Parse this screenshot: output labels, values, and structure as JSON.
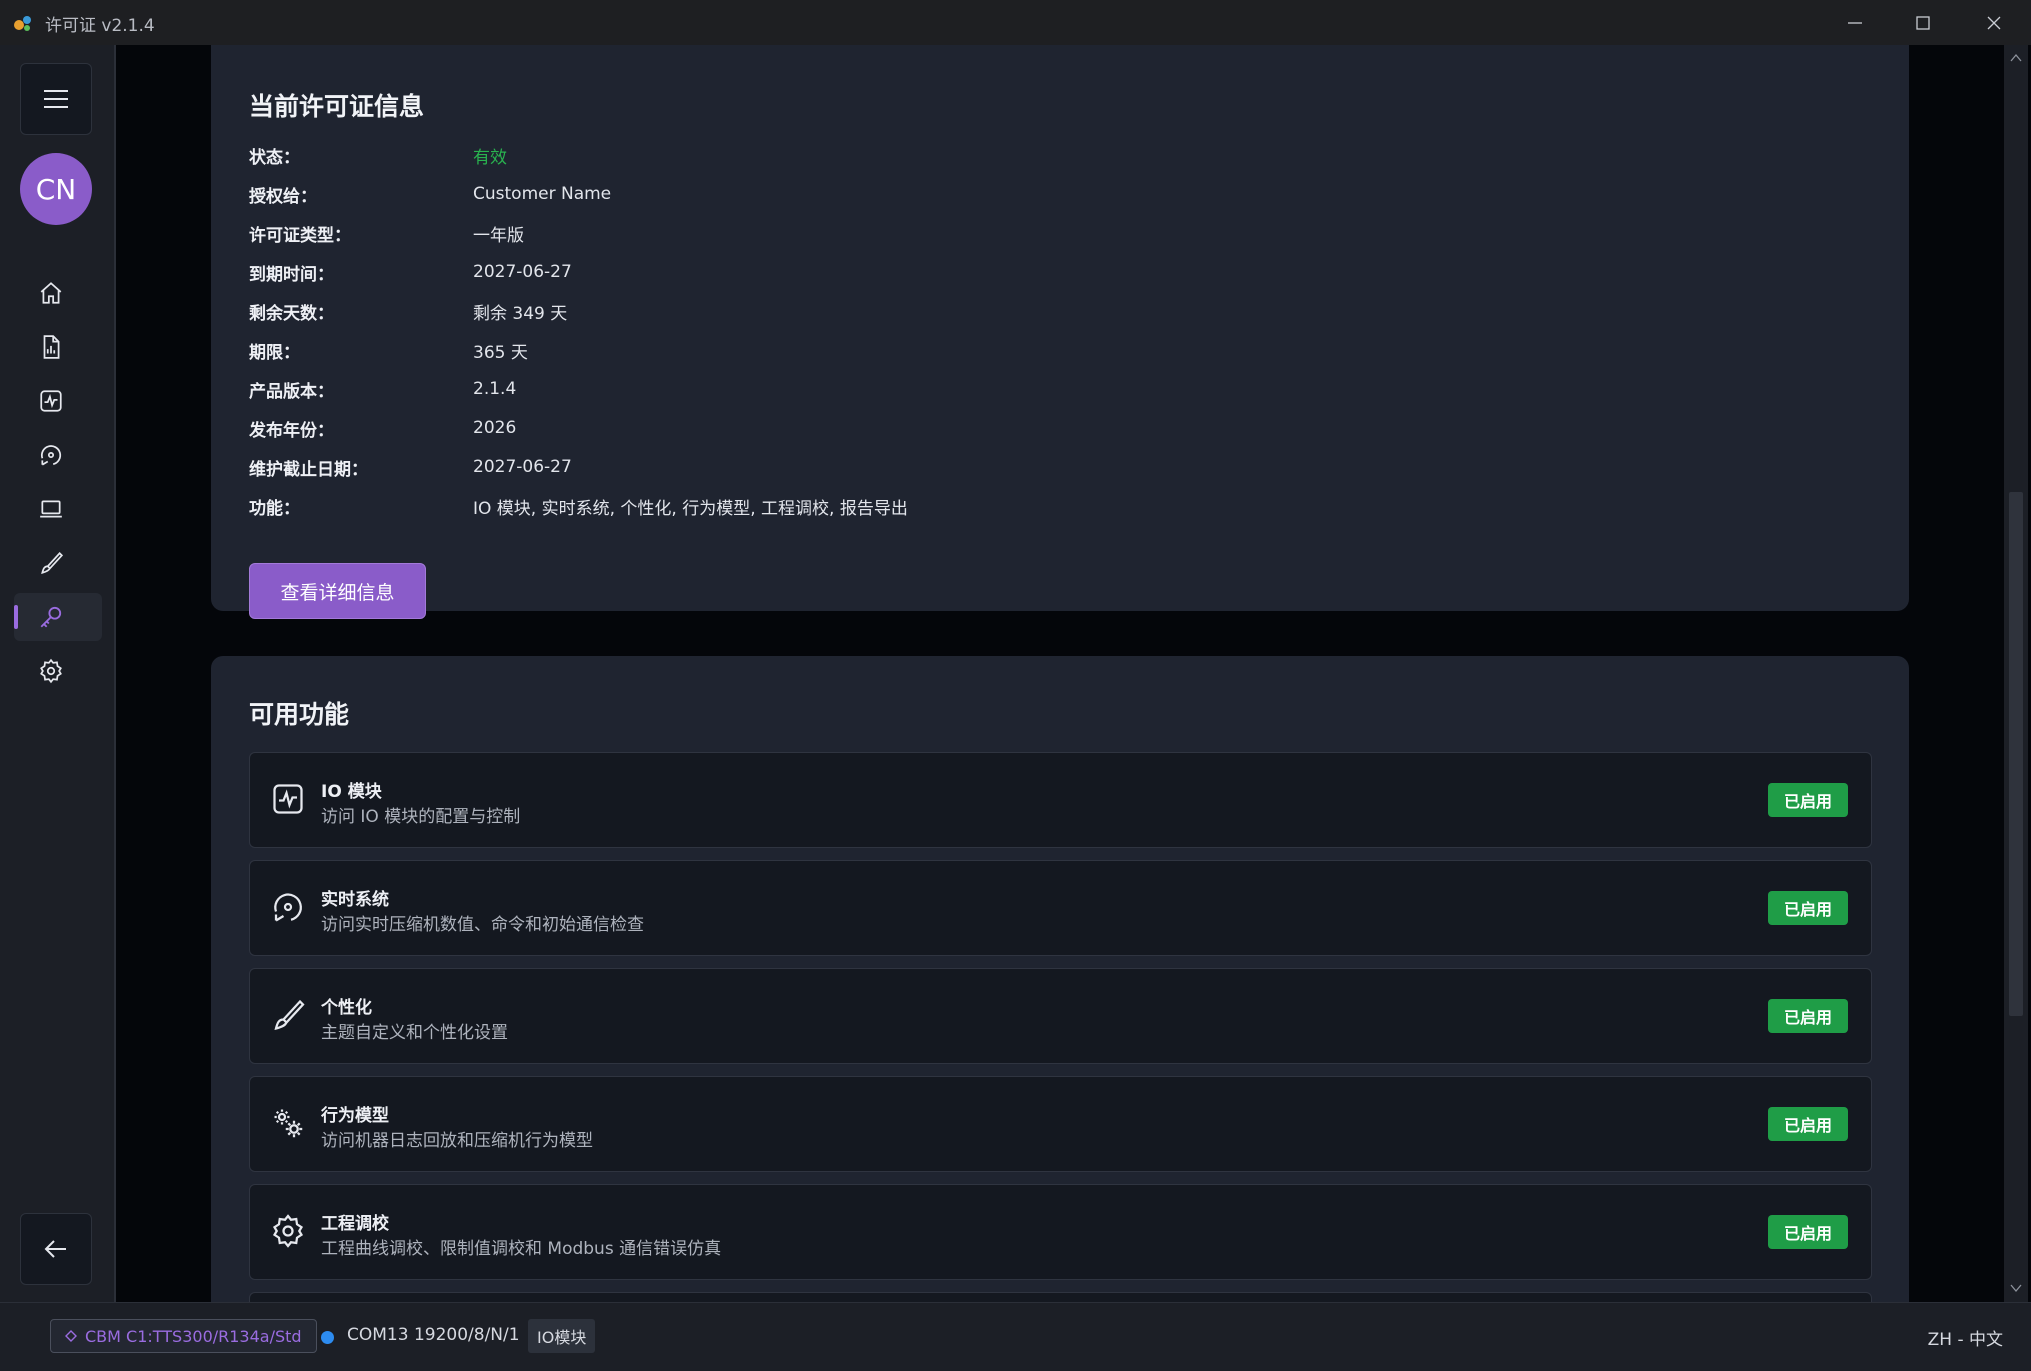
{
  "window": {
    "title": "许可证 v2.1.4"
  },
  "sidebar": {
    "avatar_initials": "CN",
    "items": [
      {
        "name": "home",
        "icon": "home-icon"
      },
      {
        "name": "report",
        "icon": "report-icon"
      },
      {
        "name": "io",
        "icon": "pulse-icon"
      },
      {
        "name": "realtime",
        "icon": "gauge-icon"
      },
      {
        "name": "device",
        "icon": "laptop-icon"
      },
      {
        "name": "personalize",
        "icon": "brush-icon"
      },
      {
        "name": "license",
        "icon": "key-icon",
        "active": true
      },
      {
        "name": "settings",
        "icon": "gear-icon"
      }
    ]
  },
  "license": {
    "title": "当前许可证信息",
    "rows": [
      {
        "label": "状态：",
        "value": "有效"
      },
      {
        "label": "授权给：",
        "value": "Customer Name"
      },
      {
        "label": "许可证类型：",
        "value": "一年版"
      },
      {
        "label": "到期时间：",
        "value": "2027-06-27"
      },
      {
        "label": "剩余天数：",
        "value": "剩余 349 天"
      },
      {
        "label": "期限：",
        "value": "365 天"
      },
      {
        "label": "产品版本：",
        "value": "2.1.4"
      },
      {
        "label": "发布年份：",
        "value": "2026"
      },
      {
        "label": "维护截止日期：",
        "value": "2027-06-27"
      },
      {
        "label": "功能：",
        "value": "IO 模块, 实时系统, 个性化, 行为模型, 工程调校, 报告导出"
      }
    ],
    "detail_button": "查看详细信息"
  },
  "features": {
    "title": "可用功能",
    "items": [
      {
        "name": "IO 模块",
        "desc": "访问 IO 模块的配置与控制",
        "badge": "已启用",
        "icon": "pulse-icon"
      },
      {
        "name": "实时系统",
        "desc": "访问实时压缩机数值、命令和初始通信检查",
        "badge": "已启用",
        "icon": "gauge-icon"
      },
      {
        "name": "个性化",
        "desc": "主题自定义和个性化设置",
        "badge": "已启用",
        "icon": "brush-icon"
      },
      {
        "name": "行为模型",
        "desc": "访问机器日志回放和压缩机行为模型",
        "badge": "已启用",
        "icon": "gears-icon"
      },
      {
        "name": "工程调校",
        "desc": "工程曲线调校、限制值调校和 Modbus 通信错误仿真",
        "badge": "已启用",
        "icon": "gear-icon"
      }
    ]
  },
  "statusbar": {
    "device": "CBM C1:TTS300/R134a/Std",
    "connection": "COM13 19200/8/N/1",
    "module": "IO模块",
    "language": "ZH - 中文"
  },
  "colors": {
    "accent": "#8a5cc9",
    "valid": "#29b34f",
    "badge": "#1f9d47",
    "connection_dot": "#2d8cf0"
  }
}
